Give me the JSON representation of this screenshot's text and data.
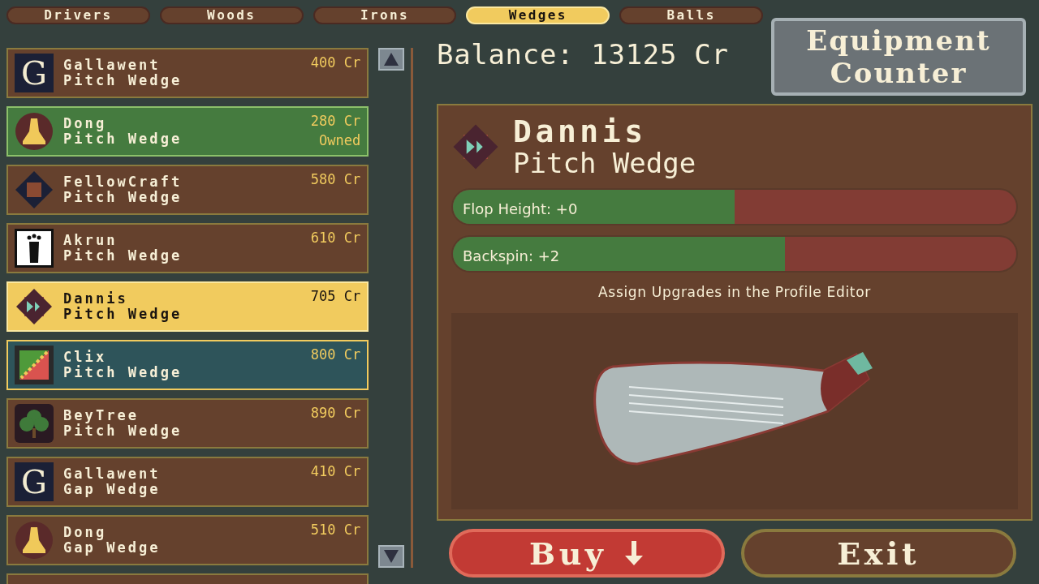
{
  "tabs": [
    {
      "label": "Drivers",
      "selected": false
    },
    {
      "label": "Woods",
      "selected": false
    },
    {
      "label": "Irons",
      "selected": false
    },
    {
      "label": "Wedges",
      "selected": true
    },
    {
      "label": "Balls",
      "selected": false
    }
  ],
  "items": [
    {
      "brand": "Gallawent",
      "club": "Pitch Wedge",
      "price": "400 Cr",
      "kind": "letter",
      "logo_letter": "G",
      "owned": false,
      "focused": false,
      "selected": false
    },
    {
      "brand": "Dong",
      "club": "Pitch Wedge",
      "price": "280 Cr",
      "status": "Owned",
      "kind": "bell",
      "owned": true,
      "focused": false,
      "selected": false
    },
    {
      "brand": "FellowCraft",
      "club": "Pitch Wedge",
      "price": "580 Cr",
      "kind": "cube",
      "owned": false,
      "focused": false,
      "selected": false
    },
    {
      "brand": "Akrun",
      "club": "Pitch Wedge",
      "price": "610 Cr",
      "kind": "foot",
      "owned": false,
      "focused": false,
      "selected": false
    },
    {
      "brand": "Dannis",
      "club": "Pitch Wedge",
      "price": "705 Cr",
      "kind": "arrows",
      "owned": false,
      "focused": false,
      "selected": true
    },
    {
      "brand": "Clix",
      "club": "Pitch Wedge",
      "price": "800 Cr",
      "kind": "flag",
      "owned": false,
      "focused": true,
      "selected": false
    },
    {
      "brand": "BeyTree",
      "club": "Pitch Wedge",
      "price": "890 Cr",
      "kind": "tree",
      "owned": false,
      "focused": false,
      "selected": false
    },
    {
      "brand": "Gallawent",
      "club": "Gap Wedge",
      "price": "410 Cr",
      "kind": "letter",
      "logo_letter": "G",
      "owned": false,
      "focused": false,
      "selected": false
    },
    {
      "brand": "Dong",
      "club": "Gap Wedge",
      "price": "510 Cr",
      "kind": "bell",
      "owned": false,
      "focused": false,
      "selected": false
    }
  ],
  "balance": "Balance: 13125 Cr",
  "title": "Equipment Counter",
  "detail": {
    "brand": "Dannis",
    "club": "Pitch Wedge",
    "kind": "arrows",
    "stats": [
      {
        "label": "Flop Height: +0",
        "level": 0.5
      },
      {
        "label": "Backspin: +2",
        "level": 0.59
      }
    ],
    "note": "Assign Upgrades in the Profile Editor"
  },
  "buttons": [
    {
      "label": "Buy",
      "kind": "buy"
    },
    {
      "label": "Exit",
      "kind": "exit"
    }
  ]
}
